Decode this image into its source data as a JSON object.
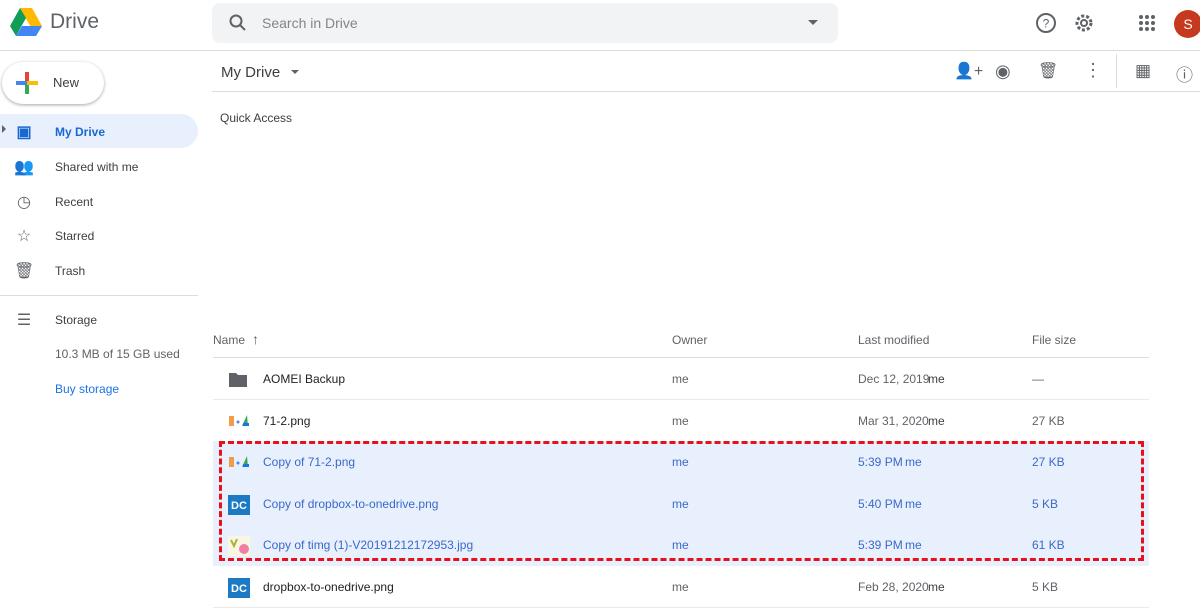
{
  "app": {
    "name": "Drive",
    "search_placeholder": "Search in Drive",
    "avatar_letter": "S"
  },
  "new_button": "New",
  "sidebar": {
    "items": [
      {
        "label": "My Drive",
        "icon": "drive-icon"
      },
      {
        "label": "Shared with me",
        "icon": "people-icon"
      },
      {
        "label": "Recent",
        "icon": "clock-icon"
      },
      {
        "label": "Starred",
        "icon": "star-icon"
      },
      {
        "label": "Trash",
        "icon": "trash-icon"
      }
    ],
    "storage_label": "Storage",
    "storage_used": "10.3 MB of 15 GB used",
    "buy_storage": "Buy storage"
  },
  "main": {
    "title": "My Drive",
    "quick_access": "Quick Access",
    "columns": {
      "name": "Name",
      "owner": "Owner",
      "modified": "Last modified",
      "size": "File size"
    },
    "files": [
      {
        "name": "AOMEI Backup",
        "owner": "me",
        "modified": "Dec 12, 2019",
        "modified_by": "me",
        "size": "—",
        "type": "folder",
        "selected": false
      },
      {
        "name": "71-2.png",
        "owner": "me",
        "modified": "Mar 31, 2020",
        "modified_by": "me",
        "size": "27 KB",
        "type": "image",
        "selected": false
      },
      {
        "name": "Copy of 71-2.png",
        "owner": "me",
        "modified": "5:39 PM",
        "modified_by": "me",
        "size": "27 KB",
        "type": "image",
        "selected": true
      },
      {
        "name": "Copy of dropbox-to-onedrive.png",
        "owner": "me",
        "modified": "5:40 PM",
        "modified_by": "me",
        "size": "5 KB",
        "type": "image-blue",
        "selected": true
      },
      {
        "name": "Copy of timg (1)-V20191212172953.jpg",
        "owner": "me",
        "modified": "5:39 PM",
        "modified_by": "me",
        "size": "61 KB",
        "type": "image-photo",
        "selected": true
      },
      {
        "name": "dropbox-to-onedrive.png",
        "owner": "me",
        "modified": "Feb 28, 2020",
        "modified_by": "me",
        "size": "5 KB",
        "type": "image-blue",
        "selected": false
      }
    ]
  },
  "colors": {
    "selection": "#e8f0fe",
    "highlight_border": "#e8101a",
    "accent": "#1967d2"
  }
}
